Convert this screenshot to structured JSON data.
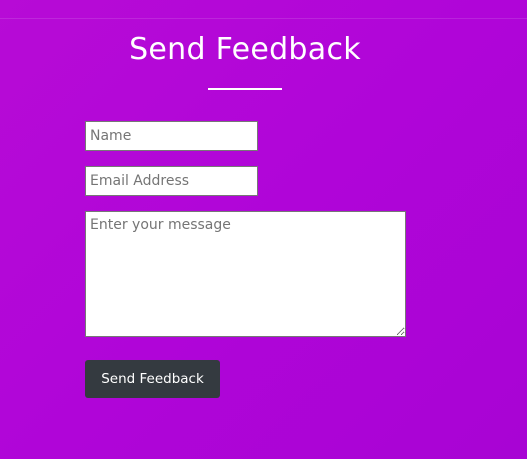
{
  "form": {
    "title": "Send Feedback",
    "name_placeholder": "Name",
    "email_placeholder": "Email Address",
    "message_placeholder": "Enter your message",
    "submit_label": "Send Feedback"
  },
  "colors": {
    "background": "#b005d8",
    "button": "#343a40",
    "text": "#ffffff"
  }
}
